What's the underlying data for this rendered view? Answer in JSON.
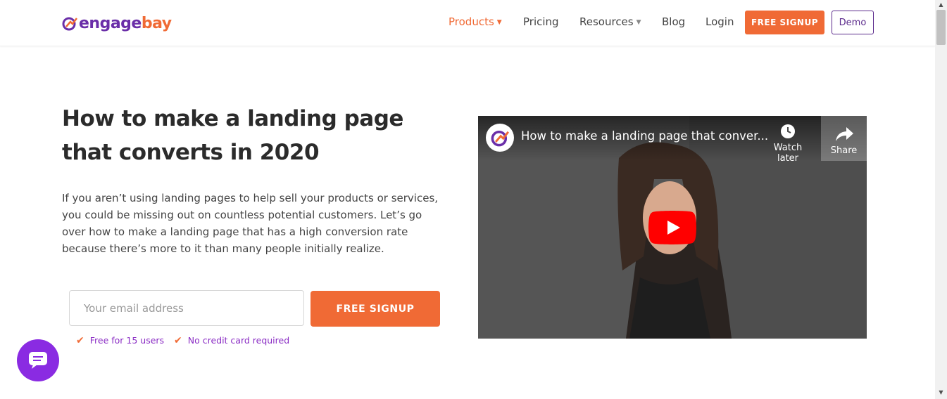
{
  "header": {
    "logo": {
      "part1": "engage",
      "part2": "bay"
    },
    "nav": [
      {
        "label": "Products",
        "has_caret": true,
        "active": true
      },
      {
        "label": "Pricing",
        "has_caret": false,
        "active": false
      },
      {
        "label": "Resources",
        "has_caret": true,
        "active": false
      },
      {
        "label": "Blog",
        "has_caret": false,
        "active": false
      },
      {
        "label": "Login",
        "has_caret": false,
        "active": false
      }
    ],
    "signup_label": "FREE SIGNUP",
    "demo_label": "Demo"
  },
  "hero": {
    "title_line1": "How to make a landing page",
    "title_line2": "that converts in 2020",
    "description": "If you aren’t using landing pages to help sell your products or services, you could be missing out on countless potential customers. Let’s go over how to make a landing page that has a high conversion rate because there’s more to it than many people initially realize.",
    "email_placeholder": "Your email address",
    "signup_label": "FREE SIGNUP",
    "perks": [
      "Free for 15 users",
      "No credit card required"
    ]
  },
  "video": {
    "title": "How to make a landing page that conver...",
    "watch_later_label": "Watch later",
    "share_label": "Share"
  },
  "icons": {
    "logo": "engagebay-logo-mark",
    "chat": "chat-icon",
    "play": "youtube-play-icon",
    "watch_later": "clock-icon",
    "share": "share-icon",
    "check": "check-icon"
  },
  "colors": {
    "brand_orange": "#f06a35",
    "brand_purple": "#6a2ea8",
    "chat_purple": "#8a2be2",
    "youtube_red": "#ff0000"
  }
}
